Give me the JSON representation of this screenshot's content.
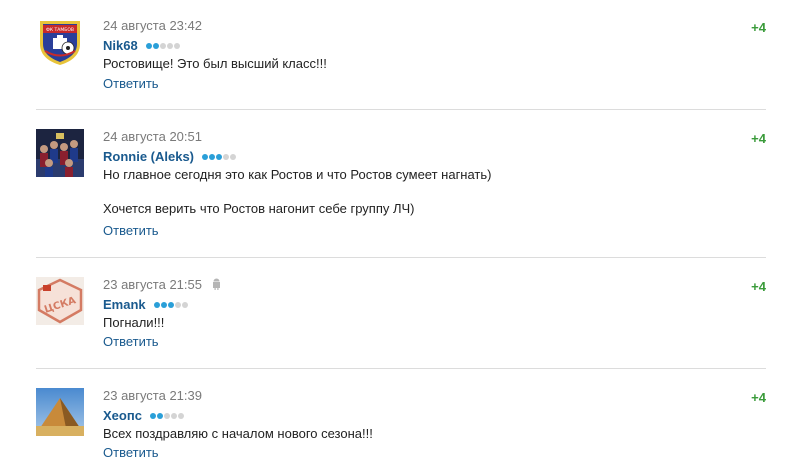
{
  "reply_label": "Ответить",
  "colors": {
    "author": "#1a5a8e",
    "score": "#3a9b3a",
    "dot_on": "#2a9fd8",
    "dot_off": "#d4d4d4",
    "divider": "#dcdcdc"
  },
  "comments": [
    {
      "datetime": "24 августа 23:42",
      "author": "Nik68",
      "rating_level": 2,
      "rating_max": 5,
      "avatar": "fc-tambov-logo",
      "avatar_text": "ФК ТАМБОВ",
      "score": "+4",
      "lines": [
        "Ростовище! Это был высший класс!!!"
      ]
    },
    {
      "datetime": "24 августа 20:51",
      "author": "Ronnie (Aleks)",
      "rating_level": 3,
      "rating_max": 5,
      "avatar": "team-photo",
      "score": "+4",
      "lines": [
        "Но главное сегодня это как Ростов и что Ростов сумеет нагнать)",
        "Хочется верить что Ростов нагонит себе группу ЛЧ)"
      ]
    },
    {
      "datetime": "23 августа 21:55",
      "author": "Emank",
      "rating_level": 3,
      "rating_max": 5,
      "avatar": "cska-logo",
      "avatar_text": "ЦСКА",
      "mobile_icon": "android-icon",
      "score": "+4",
      "lines": [
        "Погнали!!!"
      ]
    },
    {
      "datetime": "23 августа 21:39",
      "author": "Хеопс",
      "rating_level": 2,
      "rating_max": 5,
      "avatar": "pyramid-photo",
      "score": "+4",
      "lines": [
        "Всех поздравляю с началом нового сезона!!!"
      ]
    }
  ]
}
